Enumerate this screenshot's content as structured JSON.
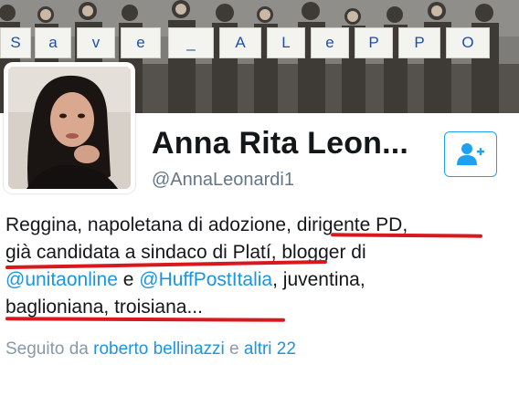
{
  "banner": {
    "sign_letters": [
      "S",
      "a",
      "v",
      "e",
      "_",
      "A",
      "L",
      "e",
      "P",
      "P",
      "O"
    ]
  },
  "profile": {
    "display_name": "Anna Rita Leon...",
    "handle": "@AnnaLeonardi1",
    "follow_icon": "add-user-icon",
    "bio": {
      "line1_a": "Reggina, napoletana di adozione, ",
      "line1_b": "dirigente PD,",
      "line2_a": "già ",
      "line2_b": "candidata a sindaco di Platí,",
      "line2_c": " blogger di",
      "line3_mention1": "@unitaonline",
      "line3_mid": " e ",
      "line3_mention2": "@HuffPostItalia",
      "line3_end": ", juventina,",
      "line4": "baglioniana, troisiana..."
    },
    "followed_by": {
      "prefix": "Seguito da ",
      "name": "roberto bellinazzi",
      "joiner": " e ",
      "others": "altri 22"
    }
  },
  "colors": {
    "link": "#1b95e0",
    "accent": "#1da1f2",
    "annotation": "#d7191f",
    "muted": "#657786"
  }
}
